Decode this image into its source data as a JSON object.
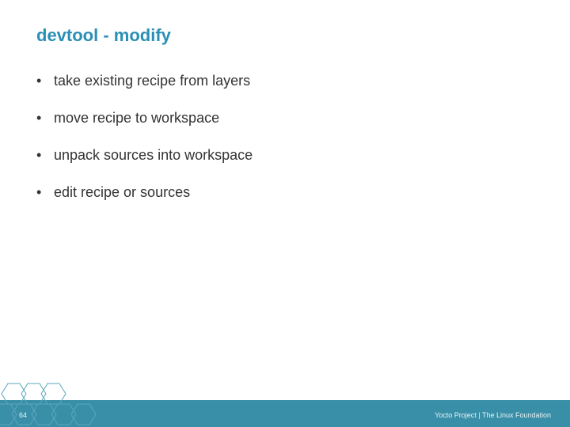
{
  "title": "devtool - modify",
  "bullets": [
    "take existing recipe from layers",
    "move recipe to workspace",
    "unpack sources into workspace",
    "edit recipe or sources"
  ],
  "page_number": "64",
  "footer_text": "Yocto Project | The Linux Foundation",
  "colors": {
    "title": "#2a8fb5",
    "footer_bg": "#3a8fa8",
    "hex_stroke": "#5aa7bd"
  }
}
